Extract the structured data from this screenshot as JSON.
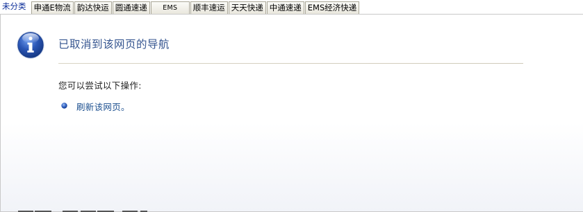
{
  "tabs": [
    {
      "label": "未分类",
      "active": true
    },
    {
      "label": "申通E物流",
      "active": false
    },
    {
      "label": "韵达快运",
      "active": false
    },
    {
      "label": "圆通速递",
      "active": false
    },
    {
      "label": "EMS",
      "active": false
    },
    {
      "label": "顺丰速运",
      "active": false
    },
    {
      "label": "天天快递",
      "active": false
    },
    {
      "label": "中通速递",
      "active": false
    },
    {
      "label": "EMS经济快递",
      "active": false
    }
  ],
  "page": {
    "icon": "info-icon",
    "title": "已取消到该网页的导航",
    "suggestion_text": "您可以尝试以下操作:",
    "actions": [
      {
        "icon": "bullet-icon",
        "label": "刷新该网页。"
      }
    ]
  },
  "colors": {
    "active_tab_text": "#0b2d99",
    "title_text": "#34548f",
    "link_text": "#1b4f8f",
    "icon_blue": "#2a55b5"
  }
}
